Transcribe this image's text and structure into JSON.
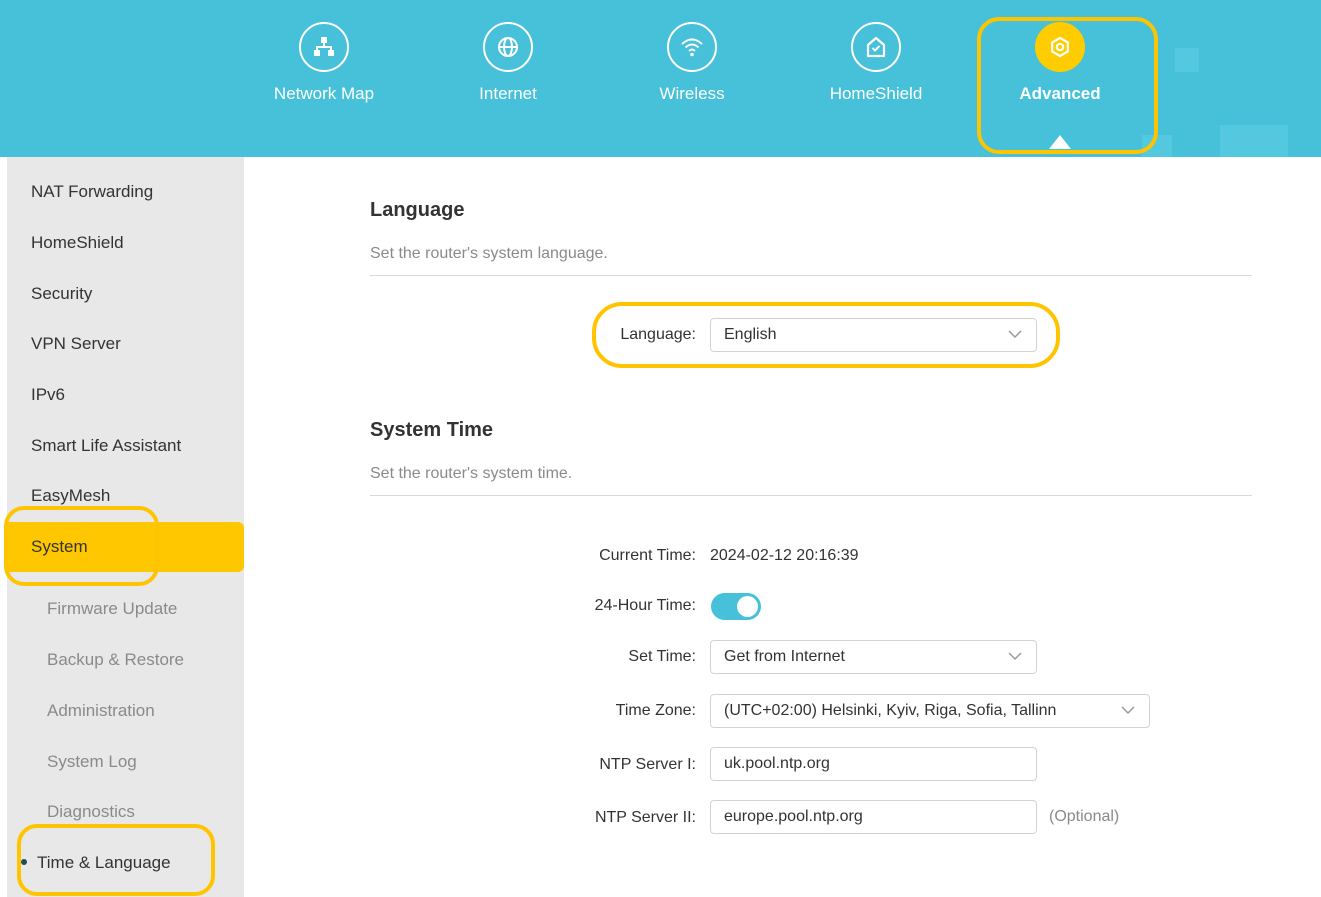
{
  "topnav": {
    "items": [
      {
        "label": "Network Map",
        "icon": "network-map-icon"
      },
      {
        "label": "Internet",
        "icon": "globe-icon"
      },
      {
        "label": "Wireless",
        "icon": "wifi-icon"
      },
      {
        "label": "HomeShield",
        "icon": "house-shield-icon"
      },
      {
        "label": "Advanced",
        "icon": "gear-icon",
        "active": true
      }
    ]
  },
  "sidebar": {
    "items": [
      {
        "label": "NAT Forwarding"
      },
      {
        "label": "HomeShield"
      },
      {
        "label": "Security"
      },
      {
        "label": "VPN Server"
      },
      {
        "label": "IPv6"
      },
      {
        "label": "Smart Life Assistant"
      },
      {
        "label": "EasyMesh"
      },
      {
        "label": "System",
        "active": true
      }
    ],
    "subitems": [
      {
        "label": "Firmware Update"
      },
      {
        "label": "Backup & Restore"
      },
      {
        "label": "Administration"
      },
      {
        "label": "System Log"
      },
      {
        "label": "Diagnostics"
      },
      {
        "label": "Time & Language",
        "current": true
      }
    ]
  },
  "language_section": {
    "title": "Language",
    "description": "Set the router's system language.",
    "language_label": "Language:",
    "language_value": "English"
  },
  "time_section": {
    "title": "System Time",
    "description": "Set the router's system time.",
    "current_time_label": "Current Time:",
    "current_time_value": "2024-02-12 20:16:39",
    "hour24_label": "24-Hour Time:",
    "hour24_on": true,
    "set_time_label": "Set Time:",
    "set_time_value": "Get from Internet",
    "timezone_label": "Time Zone:",
    "timezone_value": "(UTC+02:00) Helsinki, Kyiv, Riga, Sofia, Tallinn",
    "ntp1_label": "NTP Server I:",
    "ntp1_value": "uk.pool.ntp.org",
    "ntp2_label": "NTP Server II:",
    "ntp2_value": "europe.pool.ntp.org",
    "optional_text": "(Optional)"
  },
  "colors": {
    "header": "#46c1d9",
    "accent": "#ffc700",
    "highlight": "#ffc400"
  }
}
